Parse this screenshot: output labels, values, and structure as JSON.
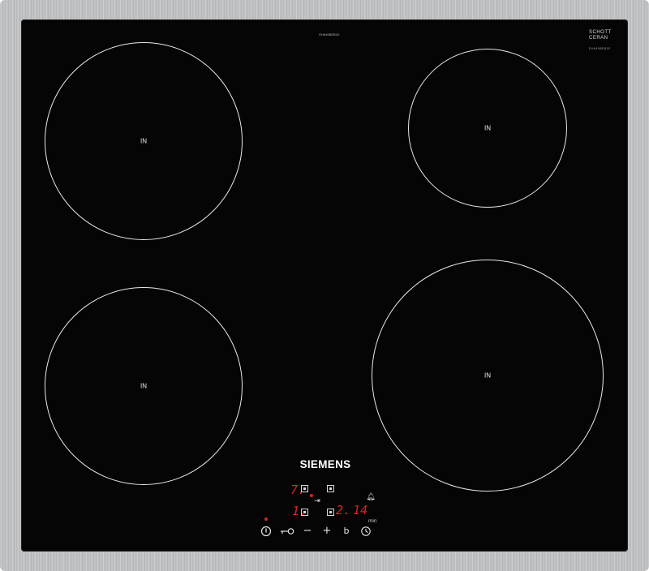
{
  "model_code": "EH645BEB1E",
  "badge": {
    "line1": "SCHOTT",
    "line2": "CERAN",
    "sub": "EH645BEB1E"
  },
  "zones": [
    {
      "id": "rear-left",
      "label": "IN"
    },
    {
      "id": "rear-right",
      "label": "IN"
    },
    {
      "id": "front-left",
      "label": "IN"
    },
    {
      "id": "front-right",
      "label": "IN"
    }
  ],
  "brand": "SIEMENS",
  "display": {
    "row1_level": "7.",
    "row2_level": "1.",
    "timer_hours": "2.",
    "timer_minutes": "14",
    "timer_unit": "min"
  },
  "controls": {
    "power_icon": "power-icon",
    "key_icon": "childlock-key-icon",
    "minus": "−",
    "plus": "+",
    "boost": "b",
    "timer_icon": "clock-icon",
    "bell_icon": "bell-icon",
    "keep_warm_icon": "pause-arrow-icon"
  },
  "colors": {
    "display_red": "#e02020",
    "glass": "#050505",
    "frame": "#c0c2c4"
  }
}
